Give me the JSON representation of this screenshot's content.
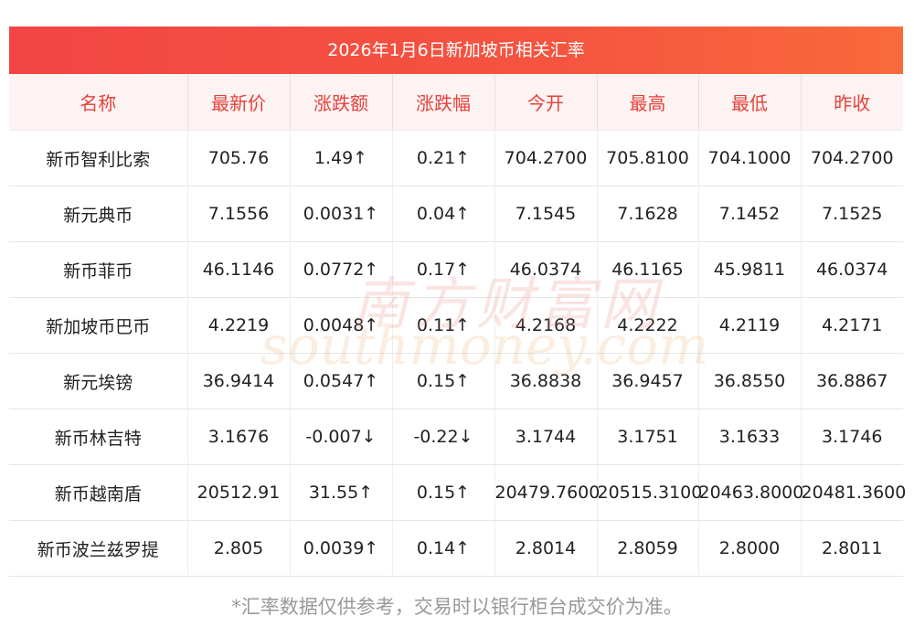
{
  "title": "2026年1月6日新加坡币相关汇率",
  "headers": [
    "名称",
    "最新价",
    "涨跌额",
    "涨跌幅",
    "今开",
    "最高",
    "最低",
    "昨收"
  ],
  "rows": [
    {
      "name": "新币智利比索",
      "latest": "705.76",
      "change": "1.49↑",
      "pct": "0.21↑",
      "open": "704.2700",
      "high": "705.8100",
      "low": "704.1000",
      "prev": "704.2700",
      "dir": "up"
    },
    {
      "name": "新元典币",
      "latest": "7.1556",
      "change": "0.0031↑",
      "pct": "0.04↑",
      "open": "7.1545",
      "high": "7.1628",
      "low": "7.1452",
      "prev": "7.1525",
      "dir": "up"
    },
    {
      "name": "新币菲币",
      "latest": "46.1146",
      "change": "0.0772↑",
      "pct": "0.17↑",
      "open": "46.0374",
      "high": "46.1165",
      "low": "45.9811",
      "prev": "46.0374",
      "dir": "up"
    },
    {
      "name": "新加坡币巴币",
      "latest": "4.2219",
      "change": "0.0048↑",
      "pct": "0.11↑",
      "open": "4.2168",
      "high": "4.2222",
      "low": "4.2119",
      "prev": "4.2171",
      "dir": "up"
    },
    {
      "name": "新元埃镑",
      "latest": "36.9414",
      "change": "0.0547↑",
      "pct": "0.15↑",
      "open": "36.8838",
      "high": "36.9457",
      "low": "36.8550",
      "prev": "36.8867",
      "dir": "up"
    },
    {
      "name": "新币林吉特",
      "latest": "3.1676",
      "change": "-0.007↓",
      "pct": "-0.22↓",
      "open": "3.1744",
      "high": "3.1751",
      "low": "3.1633",
      "prev": "3.1746",
      "dir": "down"
    },
    {
      "name": "新币越南盾",
      "latest": "20512.91",
      "change": "31.55↑",
      "pct": "0.15↑",
      "open": "20479.7600",
      "high": "20515.3100",
      "low": "20463.8000",
      "prev": "20481.3600",
      "dir": "up"
    },
    {
      "name": "新币波兰兹罗提",
      "latest": "2.805",
      "change": "0.0039↑",
      "pct": "0.14↑",
      "open": "2.8014",
      "high": "2.8059",
      "low": "2.8000",
      "prev": "2.8011",
      "dir": "up"
    }
  ],
  "watermark": {
    "cn": "南方财富网",
    "en": "southmoney.com"
  },
  "footnote": "*汇率数据仅供参考，交易时以银行柜台成交价为准。",
  "colors": {
    "accent": "#f24545",
    "up": "#e8201f",
    "down": "#1f8a1f",
    "header_text": "#e7413a"
  }
}
